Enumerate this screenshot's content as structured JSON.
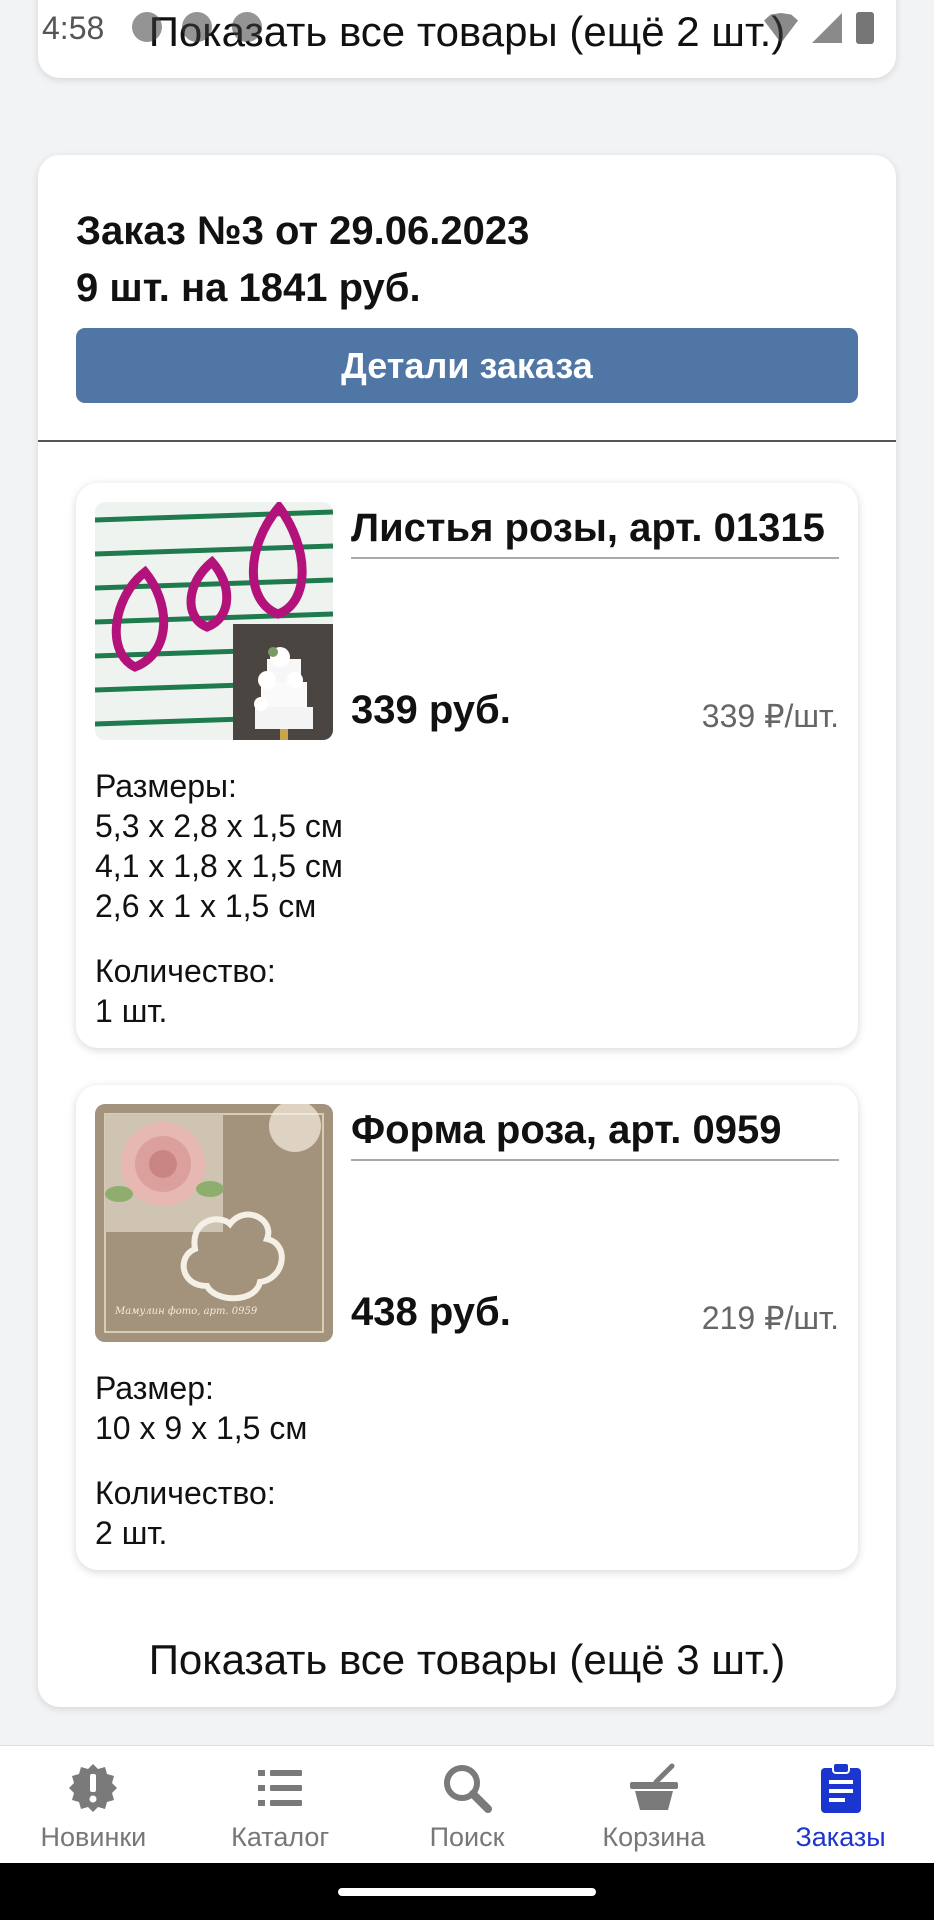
{
  "status_bar": {
    "time": "4:58"
  },
  "previous_order": {
    "show_more_label": "Показать все товары (ещё 2 шт.)"
  },
  "order": {
    "title": "Заказ №3 от 29.06.2023",
    "summary": "9 шт. на 1841 руб.",
    "details_button": "Детали заказа",
    "items": [
      {
        "name": "Листья розы, арт. 01315",
        "total_price": "339 руб.",
        "unit_price": "339 ₽/шт.",
        "size_label": "Размеры:",
        "sizes": [
          "5,3 x 2,8 x 1,5 см",
          "4,1 x 1,8 x 1,5 см",
          "2,6 x 1 x 1,5 см"
        ],
        "quantity_label": "Количество:",
        "quantity": "1 шт."
      },
      {
        "name": "Форма роза, арт. 0959",
        "total_price": "438 руб.",
        "unit_price": "219 ₽/шт.",
        "size_label": "Размер:",
        "sizes": [
          "10 x 9 x 1,5 см"
        ],
        "quantity_label": "Количество:",
        "quantity": "2 шт."
      }
    ],
    "show_more_label": "Показать все товары (ещё 3 шт.)"
  },
  "bottom_nav": {
    "items": [
      {
        "label": "Новинки",
        "icon": "alert-badge-icon",
        "active": false
      },
      {
        "label": "Каталог",
        "icon": "list-icon",
        "active": false
      },
      {
        "label": "Поиск",
        "icon": "search-icon",
        "active": false
      },
      {
        "label": "Корзина",
        "icon": "basket-icon",
        "active": false
      },
      {
        "label": "Заказы",
        "icon": "clipboard-list-icon",
        "active": true
      }
    ]
  },
  "colors": {
    "primary_button": "#4f76a4",
    "active_nav": "#1a35d0",
    "inactive_nav": "#777777",
    "background": "#f2f3f5"
  }
}
